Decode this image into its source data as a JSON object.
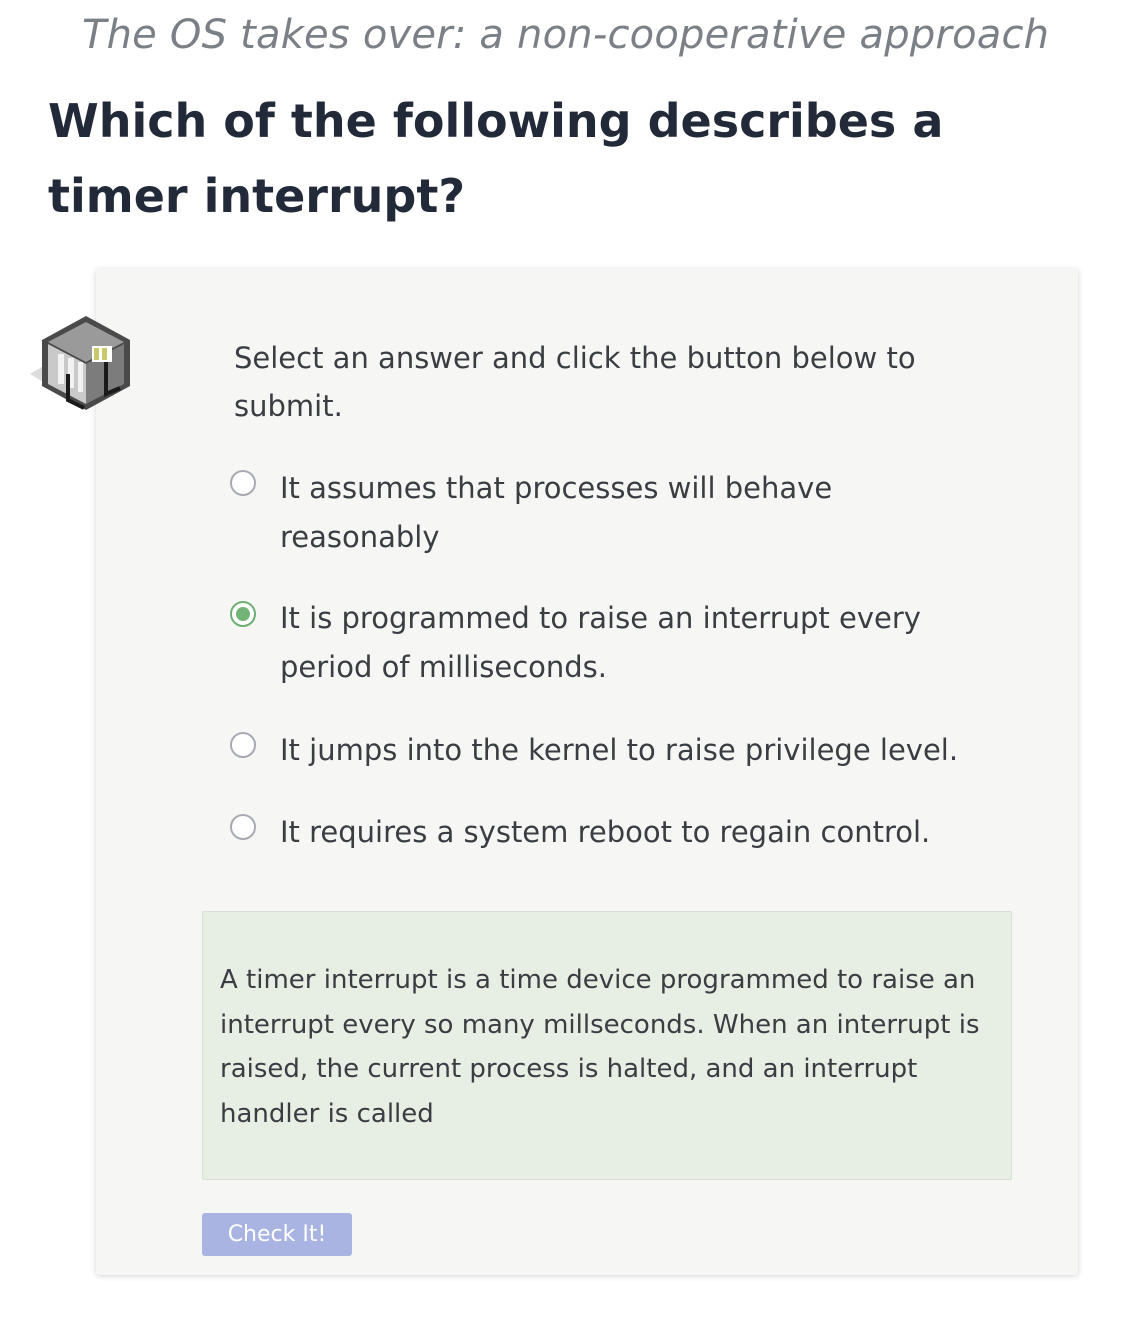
{
  "header": {
    "subtitle": "The OS takes over: a non-cooperative approach",
    "question": "Which of the following describes a timer interrupt?"
  },
  "quiz": {
    "logo_icon": "server-cube-icon",
    "instructions": "Select an answer and click the button below to submit.",
    "options": [
      {
        "label": "It assumes that processes will behave reasonably",
        "selected": false
      },
      {
        "label": "It is programmed to raise an interrupt every period of milliseconds.",
        "selected": true
      },
      {
        "label": "It jumps into the kernel to raise privilege level.",
        "selected": false
      },
      {
        "label": "It requires a system reboot to regain control.",
        "selected": false
      }
    ],
    "feedback": "A timer interrupt is a time device programmed to raise an interrupt every so many millseconds. When an interrupt is raised, the current process is halted, and an interrupt handler is called",
    "check_button_label": "Check It!"
  },
  "colors": {
    "selected_radio": "#74b378",
    "button": "#a9b4e2",
    "feedback_bg": "#e7eee4",
    "card_bg": "#f6f7f5"
  }
}
